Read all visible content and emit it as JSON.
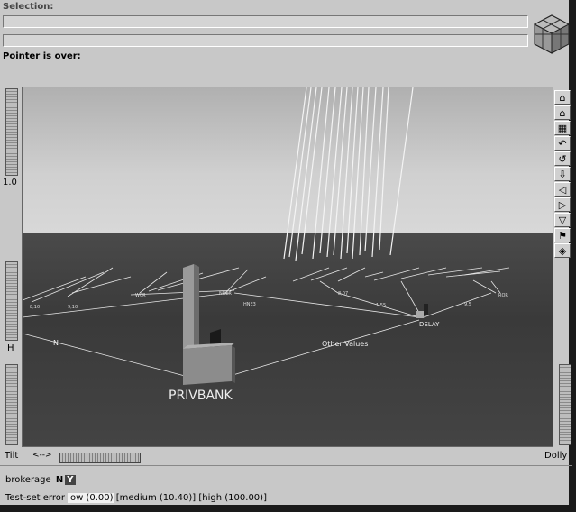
{
  "header": {
    "selection_label": "Selection:",
    "pointer_label": "Pointer is over:"
  },
  "left_controls": {
    "zoom_value": "1.0",
    "h_label": "H"
  },
  "bottom_controls": {
    "tilt_label": "Tilt",
    "tilt_arrow": "<-->",
    "dolly_label": "Dolly"
  },
  "attribute": {
    "name": "brokerage",
    "values": [
      "N",
      "Y"
    ]
  },
  "error": {
    "label": "Test-set error",
    "levels": [
      "low (0.00)",
      "[medium (10.40)]",
      "[high (100.00)]"
    ]
  },
  "scene": {
    "root_label": "PRIVBANK",
    "child_label": "DELAY",
    "edge_n": "N",
    "edge_other": "Other Values",
    "node_labels": [
      "8,10",
      "9,10",
      "W0R",
      "NRER",
      "HNE3",
      "8,07",
      "1,55",
      "9,5",
      "ROR"
    ]
  },
  "toolbar_icons": [
    "home-icon",
    "set-home-icon",
    "view-all-icon",
    "undo-icon",
    "rotate-left-icon",
    "seek-icon",
    "pan-left-icon",
    "pan-right-icon",
    "select-icon",
    "flag-icon",
    "perspective-icon"
  ]
}
